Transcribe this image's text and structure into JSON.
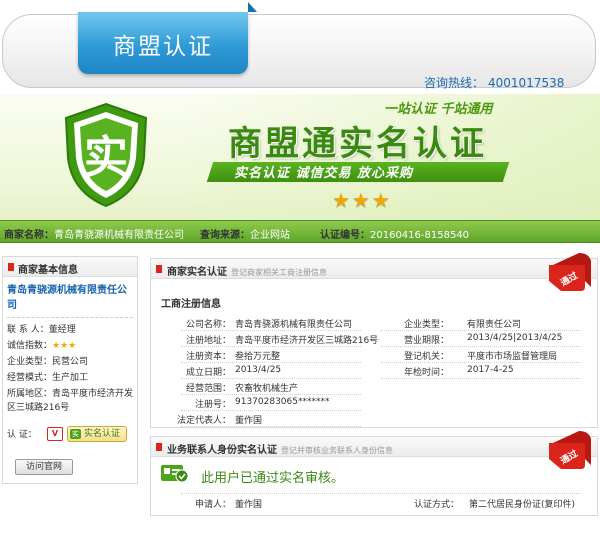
{
  "header": {
    "tab_title": "商盟认证",
    "hotline_label": "咨询热线：",
    "hotline_number": "4001017538"
  },
  "banner": {
    "slogan_top": "一站认证  千站通用",
    "brand": "商盟通实名认证",
    "slogan_bar": "实名认证    诚信交易    放心采购",
    "shield_glyph": "实",
    "stars": "★★★"
  },
  "info_bar": {
    "merchant_label": "商家名称：",
    "merchant_value": "青岛青骁源机械有限责任公司",
    "source_label": "查询来源：",
    "source_value": "企业网站",
    "cert_label": "认证编号：",
    "cert_value": "20160416-8158540"
  },
  "left_panel": {
    "title": "商家基本信息",
    "company_name": "青岛青骁源机械有限责任公司",
    "contact_label": "联 系 人：",
    "contact_value": "董经理",
    "rating_label": "诚信指数：",
    "rating_stars": "★★★",
    "type_label": "企业类型：",
    "type_value": "民营公司",
    "mode_label": "经营模式：",
    "mode_value": "生产加工",
    "region_label": "所属地区：",
    "region_value": "青岛平度市经济开发区三城路216号",
    "cert_label": "认    证：",
    "cert_v": "V",
    "cert_real": "实名认证",
    "cert_real_glyph": "实",
    "visit_button": "访问官网"
  },
  "section_real": {
    "title": "商家实名认证",
    "subtitle": "登记商家相关工商注册信息",
    "ribbon_text": "通过",
    "sub_title": "工商注册信息",
    "fields_left": [
      {
        "label": "公司名称：",
        "value": "青岛青骁源机械有限责任公司"
      },
      {
        "label": "注册地址：",
        "value": "青岛平度市经济开发区三城路216号"
      },
      {
        "label": "注册资本：",
        "value": "叁拾万元整"
      },
      {
        "label": "成立日期：",
        "value": "2013/4/25"
      },
      {
        "label": "经营范围：",
        "value": "农畜牧机械生产"
      },
      {
        "label": "注册号：",
        "value": "91370283065*******"
      },
      {
        "label": "法定代表人：",
        "value": "董作国"
      }
    ],
    "fields_right": [
      {
        "label": "企业类型：",
        "value": "有限责任公司"
      },
      {
        "label": "营业期限：",
        "value": "2013/4/25|2013/4/25"
      },
      {
        "label": "登记机关：",
        "value": "平度市市场监督管理局"
      },
      {
        "label": "年检时间：",
        "value": "2017-4-25"
      }
    ]
  },
  "section_identity": {
    "title": "业务联系人身份实名认证",
    "subtitle": "登记并审核业务联系人身份信息",
    "ribbon_text": "通过",
    "passed_text": "此用户已通过实名审核。",
    "applicant_label": "申请人：",
    "applicant_value": "董作国",
    "method_label": "认证方式：",
    "method_value": "第二代居民身份证(复印件)"
  },
  "colors": {
    "accent_green": "#3a8a12",
    "link_blue": "#1a64b0",
    "tab_blue": "#2f9ad6",
    "ribbon_red": "#d9251b",
    "star_gold": "#f0a800"
  }
}
